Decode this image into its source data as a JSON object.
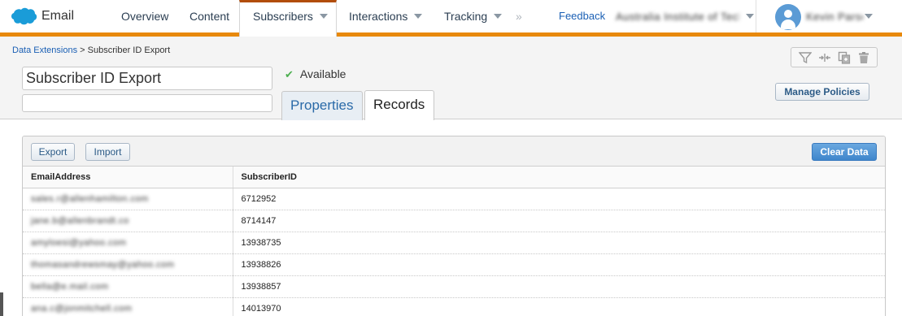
{
  "app": {
    "name": "Email"
  },
  "nav": {
    "overview": "Overview",
    "content": "Content",
    "subscribers": "Subscribers",
    "interactions": "Interactions",
    "tracking": "Tracking",
    "more": "»",
    "feedback": "Feedback",
    "account": "Australia Institute of Technology",
    "user": "Kevin Parsons"
  },
  "breadcrumb": {
    "parent": "Data Extensions",
    "separator": ">",
    "current": "Subscriber ID Export"
  },
  "extension": {
    "name": "Subscriber ID Export",
    "description": "",
    "status": "Available"
  },
  "tabs": {
    "properties": "Properties",
    "records": "Records"
  },
  "buttons": {
    "manage_policies": "Manage Policies",
    "export": "Export",
    "import": "Import",
    "clear_data": "Clear Data"
  },
  "icons": {
    "filter": "filter-icon",
    "columns": "columns-icon",
    "copy": "copy-icon",
    "delete": "trash-icon",
    "status": "check-icon"
  },
  "colors": {
    "accent": "#e8890c",
    "active_tab_top": "#b24d0b",
    "link": "#1a5fb4",
    "primary_button": "#3f86cc",
    "check": "#4caf50"
  },
  "table": {
    "columns": [
      "EmailAddress",
      "SubscriberID"
    ],
    "rows": [
      [
        "sales.r@allenhamilton.com",
        "6712952"
      ],
      [
        "jane.b@allenbrandt.co",
        "8714147"
      ],
      [
        "amyloesi@yahoo.com",
        "13938735"
      ],
      [
        "thomasandrewsmay@yahoo.com",
        "13938826"
      ],
      [
        "bella@e.mail.com",
        "13938857"
      ],
      [
        "ana.c@jonmitchell.com",
        "14013970"
      ]
    ]
  }
}
